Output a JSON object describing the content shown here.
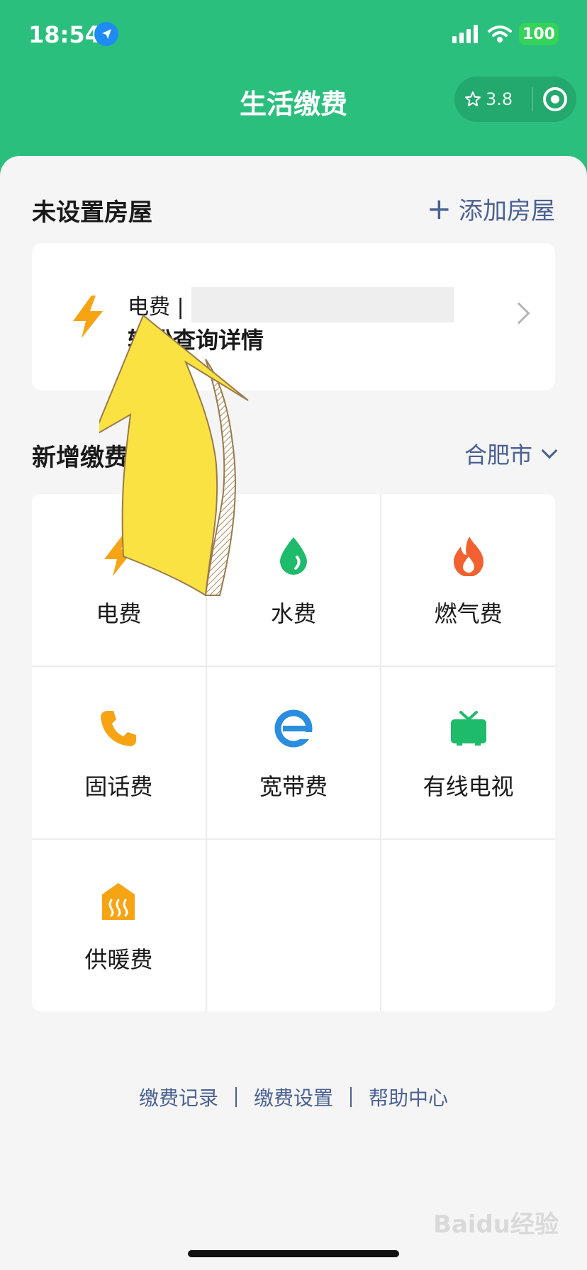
{
  "status_bar": {
    "time": "18:54",
    "battery": "100"
  },
  "nav": {
    "title": "生活缴费",
    "rating": "3.8"
  },
  "house_section": {
    "title": "未设置房屋",
    "add_label": "添加房屋"
  },
  "elec_card": {
    "line1": "电费 | ",
    "line2": "轻松查询详情"
  },
  "new_section": {
    "title": "新增缴费",
    "city": "合肥市"
  },
  "services": [
    {
      "label": "电费",
      "icon": "lightning-icon",
      "color": "#f7a414"
    },
    {
      "label": "水费",
      "icon": "water-drop-icon",
      "color": "#1dbb6a"
    },
    {
      "label": "燃气费",
      "icon": "flame-icon",
      "color": "#f2612f"
    },
    {
      "label": "固话费",
      "icon": "phone-icon",
      "color": "#f7a414"
    },
    {
      "label": "宽带费",
      "icon": "browser-e-icon",
      "color": "#2a8de0"
    },
    {
      "label": "有线电视",
      "icon": "tv-icon",
      "color": "#1dbb6a"
    },
    {
      "label": "供暖费",
      "icon": "heating-house-icon",
      "color": "#f7a414"
    }
  ],
  "footer": {
    "links": [
      "缴费记录",
      "缴费设置",
      "帮助中心"
    ]
  },
  "watermark": "Baidu经验"
}
